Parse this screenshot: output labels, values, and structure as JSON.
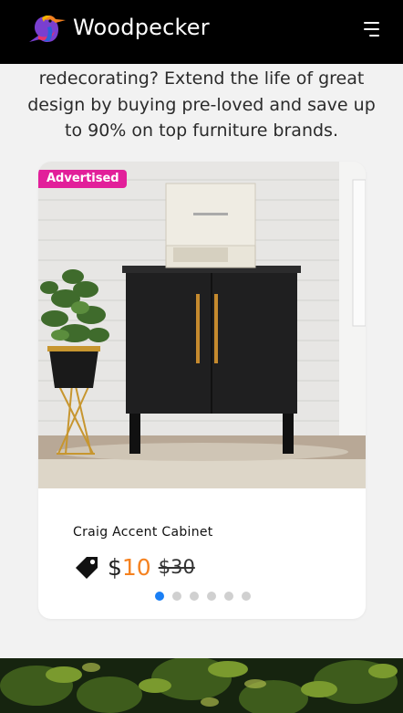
{
  "header": {
    "brand": "Woodpecker",
    "logo_icon": "woodpecker-bird-icon",
    "menu_icon": "hamburger-menu-icon"
  },
  "intro": {
    "text": "redecorating? Extend the life of great design by buying pre-loved and save up to 90% on top furniture brands."
  },
  "card": {
    "badge": "Advertised",
    "badge_color": "#e21f9a",
    "product_name": "Craig Accent Cabinet",
    "price_currency": "$",
    "price_current": "10",
    "price_original": "$30",
    "price_color": "#f58220",
    "tag_icon": "price-tag-icon",
    "carousel": {
      "total": 6,
      "active_index": 0,
      "active_color": "#1a7ff5"
    }
  },
  "colors": {
    "header_bg": "#000000",
    "page_bg": "#f2f2f2"
  }
}
